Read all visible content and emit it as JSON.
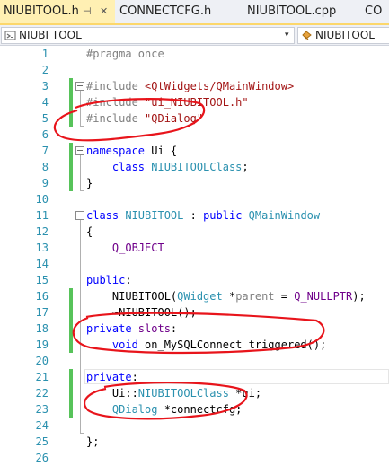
{
  "tabs": [
    {
      "label": "NIUBITOOL.h",
      "pin": "⊣",
      "close": "✕",
      "active": true
    },
    {
      "label": "CONNECTCFG.h",
      "active": false
    },
    {
      "label": "NIUBITOOL.cpp",
      "active": false
    },
    {
      "label": "CO",
      "active": false
    }
  ],
  "nav": {
    "scope_icon": "class-scope-icon",
    "scope_label": "NIUBI TOOL",
    "dropdown_glyph": "▾",
    "member_icon": "class-member-icon",
    "member_label": "NIUBITOOL"
  },
  "code_lines": [
    {
      "no": "1",
      "tokens": [
        {
          "t": "#pragma once",
          "c": "pp"
        }
      ]
    },
    {
      "no": "2",
      "tokens": []
    },
    {
      "no": "3",
      "tokens": [
        {
          "t": "#include ",
          "c": "pp"
        },
        {
          "t": "<QtWidgets/QMainWindow>",
          "c": "str"
        }
      ]
    },
    {
      "no": "4",
      "tokens": [
        {
          "t": "#include ",
          "c": "pp"
        },
        {
          "t": "\"ui_NIUBITOOL.h\"",
          "c": "str"
        }
      ]
    },
    {
      "no": "5",
      "tokens": [
        {
          "t": "#include ",
          "c": "pp"
        },
        {
          "t": "\"QDialog\"",
          "c": "str"
        }
      ]
    },
    {
      "no": "6",
      "tokens": []
    },
    {
      "no": "7",
      "tokens": [
        {
          "t": "namespace ",
          "c": "kw"
        },
        {
          "t": "Ui {",
          "c": "plain"
        }
      ]
    },
    {
      "no": "8",
      "tokens": [
        {
          "t": "    class ",
          "c": "kw"
        },
        {
          "t": "NIUBITOOLClass",
          "c": "ty"
        },
        {
          "t": ";",
          "c": "plain"
        }
      ]
    },
    {
      "no": "9",
      "tokens": [
        {
          "t": "}",
          "c": "plain"
        }
      ]
    },
    {
      "no": "10",
      "tokens": []
    },
    {
      "no": "11",
      "tokens": [
        {
          "t": "class ",
          "c": "kw"
        },
        {
          "t": "NIUBITOOL",
          "c": "ty"
        },
        {
          "t": " : ",
          "c": "plain"
        },
        {
          "t": "public ",
          "c": "kw"
        },
        {
          "t": "QMainWindow",
          "c": "ty"
        }
      ]
    },
    {
      "no": "12",
      "tokens": [
        {
          "t": "{",
          "c": "plain"
        }
      ]
    },
    {
      "no": "13",
      "tokens": [
        {
          "t": "    Q_OBJECT",
          "c": "mac"
        }
      ]
    },
    {
      "no": "14",
      "tokens": []
    },
    {
      "no": "15",
      "tokens": [
        {
          "t": "public",
          "c": "kw"
        },
        {
          "t": ":",
          "c": "plain"
        }
      ]
    },
    {
      "no": "16",
      "tokens": [
        {
          "t": "    NIUBITOOL(",
          "c": "plain"
        },
        {
          "t": "QWidget",
          "c": "ty"
        },
        {
          "t": " *",
          "c": "plain"
        },
        {
          "t": "parent",
          "c": "par"
        },
        {
          "t": " = ",
          "c": "plain"
        },
        {
          "t": "Q_NULLPTR",
          "c": "mac"
        },
        {
          "t": ");",
          "c": "plain"
        }
      ]
    },
    {
      "no": "17",
      "tokens": [
        {
          "t": "    ~NIUBITOOL();",
          "c": "plain"
        }
      ]
    },
    {
      "no": "18",
      "tokens": [
        {
          "t": "private ",
          "c": "kw"
        },
        {
          "t": "slots",
          "c": "mac"
        },
        {
          "t": ":",
          "c": "plain"
        }
      ]
    },
    {
      "no": "19",
      "tokens": [
        {
          "t": "    ",
          "c": "plain"
        },
        {
          "t": "void",
          "c": "kw"
        },
        {
          "t": " on_MySQLConnect_triggered();",
          "c": "plain"
        }
      ]
    },
    {
      "no": "20",
      "tokens": []
    },
    {
      "no": "21",
      "tokens": [
        {
          "t": "private",
          "c": "kw"
        },
        {
          "t": ":",
          "c": "plain"
        }
      ]
    },
    {
      "no": "22",
      "tokens": [
        {
          "t": "    Ui::",
          "c": "plain"
        },
        {
          "t": "NIUBITOOLClass",
          "c": "ty"
        },
        {
          "t": " *ui;",
          "c": "plain"
        }
      ]
    },
    {
      "no": "23",
      "tokens": [
        {
          "t": "    ",
          "c": "plain"
        },
        {
          "t": "QDialog",
          "c": "ty"
        },
        {
          "t": " *connectcfg;",
          "c": "plain"
        }
      ]
    },
    {
      "no": "24",
      "tokens": []
    },
    {
      "no": "25",
      "tokens": [
        {
          "t": "};",
          "c": "plain"
        }
      ]
    },
    {
      "no": "26",
      "tokens": []
    }
  ],
  "colors": {
    "keyword": "#0000ff",
    "type": "#2b91af",
    "string": "#a31515",
    "preprocessor": "#808080",
    "macro": "#6f008a",
    "change_marker": "#57c35a",
    "annotation": "#e8141b",
    "active_tab": "#fff0b3"
  }
}
